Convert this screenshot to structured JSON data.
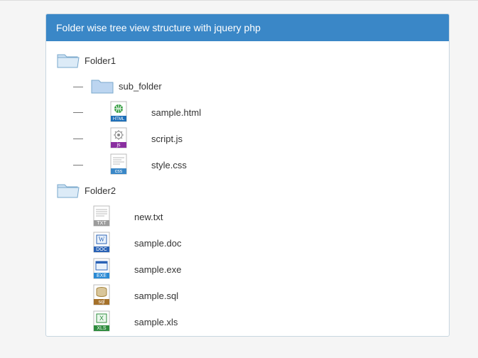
{
  "header": {
    "title": "Folder wise tree view structure with jquery php"
  },
  "tree": {
    "nodes": [
      {
        "name": "Folder1",
        "children": [
          {
            "name": "sub_folder"
          },
          {
            "name": "sample.html"
          },
          {
            "name": "script.js"
          },
          {
            "name": "style.css"
          }
        ]
      },
      {
        "name": "Folder2",
        "children": [
          {
            "name": "new.txt"
          },
          {
            "name": "sample.doc"
          },
          {
            "name": "sample.exe"
          },
          {
            "name": "sample.sql"
          },
          {
            "name": "sample.xls"
          }
        ]
      }
    ]
  },
  "icons": {
    "html_badge": "HTML",
    "js_badge": "js",
    "css_badge": "css",
    "txt_badge": "TXT",
    "doc_badge": "DOC",
    "exe_badge": "EXE",
    "sql_badge": "sql",
    "xls_badge": "XLS"
  }
}
